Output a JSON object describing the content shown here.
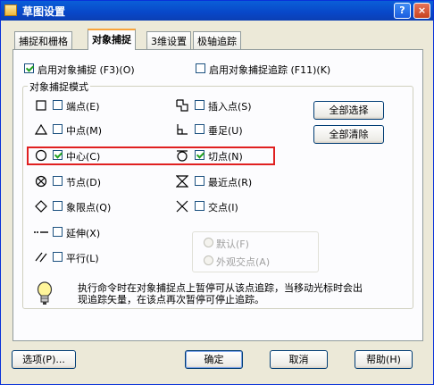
{
  "window": {
    "title": "草图设置",
    "help_glyph": "?",
    "close_glyph": "×"
  },
  "tabs": [
    {
      "label": "捕捉和栅格"
    },
    {
      "label": "对象捕捉"
    },
    {
      "label": "3维设置"
    },
    {
      "label": "极轴追踪"
    }
  ],
  "options": {
    "enable_osnap": {
      "label": "启用对象捕捉 (F3)(O)",
      "checked": true
    },
    "enable_tracking": {
      "label": "启用对象捕捉追踪 (F11)(K)",
      "checked": false
    }
  },
  "modes": {
    "group_title": "对象捕捉模式",
    "left": [
      {
        "label": "端点(E)",
        "icon": "endpoint-icon",
        "checked": false
      },
      {
        "label": "中点(M)",
        "icon": "midpoint-icon",
        "checked": false
      },
      {
        "label": "中心(C)",
        "icon": "center-icon",
        "checked": true
      },
      {
        "label": "节点(D)",
        "icon": "node-icon",
        "checked": false
      },
      {
        "label": "象限点(Q)",
        "icon": "quadrant-icon",
        "checked": false
      },
      {
        "label": "延伸(X)",
        "icon": "extension-icon",
        "checked": false
      },
      {
        "label": "平行(L)",
        "icon": "parallel-icon",
        "checked": false
      }
    ],
    "right": [
      {
        "label": "插入点(S)",
        "icon": "insertion-icon",
        "checked": false
      },
      {
        "label": "垂足(U)",
        "icon": "perpendicular-icon",
        "checked": false
      },
      {
        "label": "切点(N)",
        "icon": "tangent-icon",
        "checked": true
      },
      {
        "label": "最近点(R)",
        "icon": "nearest-icon",
        "checked": false
      },
      {
        "label": "交点(I)",
        "icon": "intersection-icon",
        "checked": false
      }
    ],
    "radio_default": "默认(F)",
    "radio_apparent": "外观交点(A)",
    "select_all": "全部选择",
    "clear_all": "全部清除"
  },
  "hint": {
    "line1": "执行命令时在对象捕捉点上暂停可从该点追踪，当移动光标时会出",
    "line2": "现追踪矢量，在该点再次暂停可停止追踪。"
  },
  "footer": {
    "options": "选项(P)...",
    "ok": "确定",
    "cancel": "取消",
    "help": "帮助(H)"
  }
}
